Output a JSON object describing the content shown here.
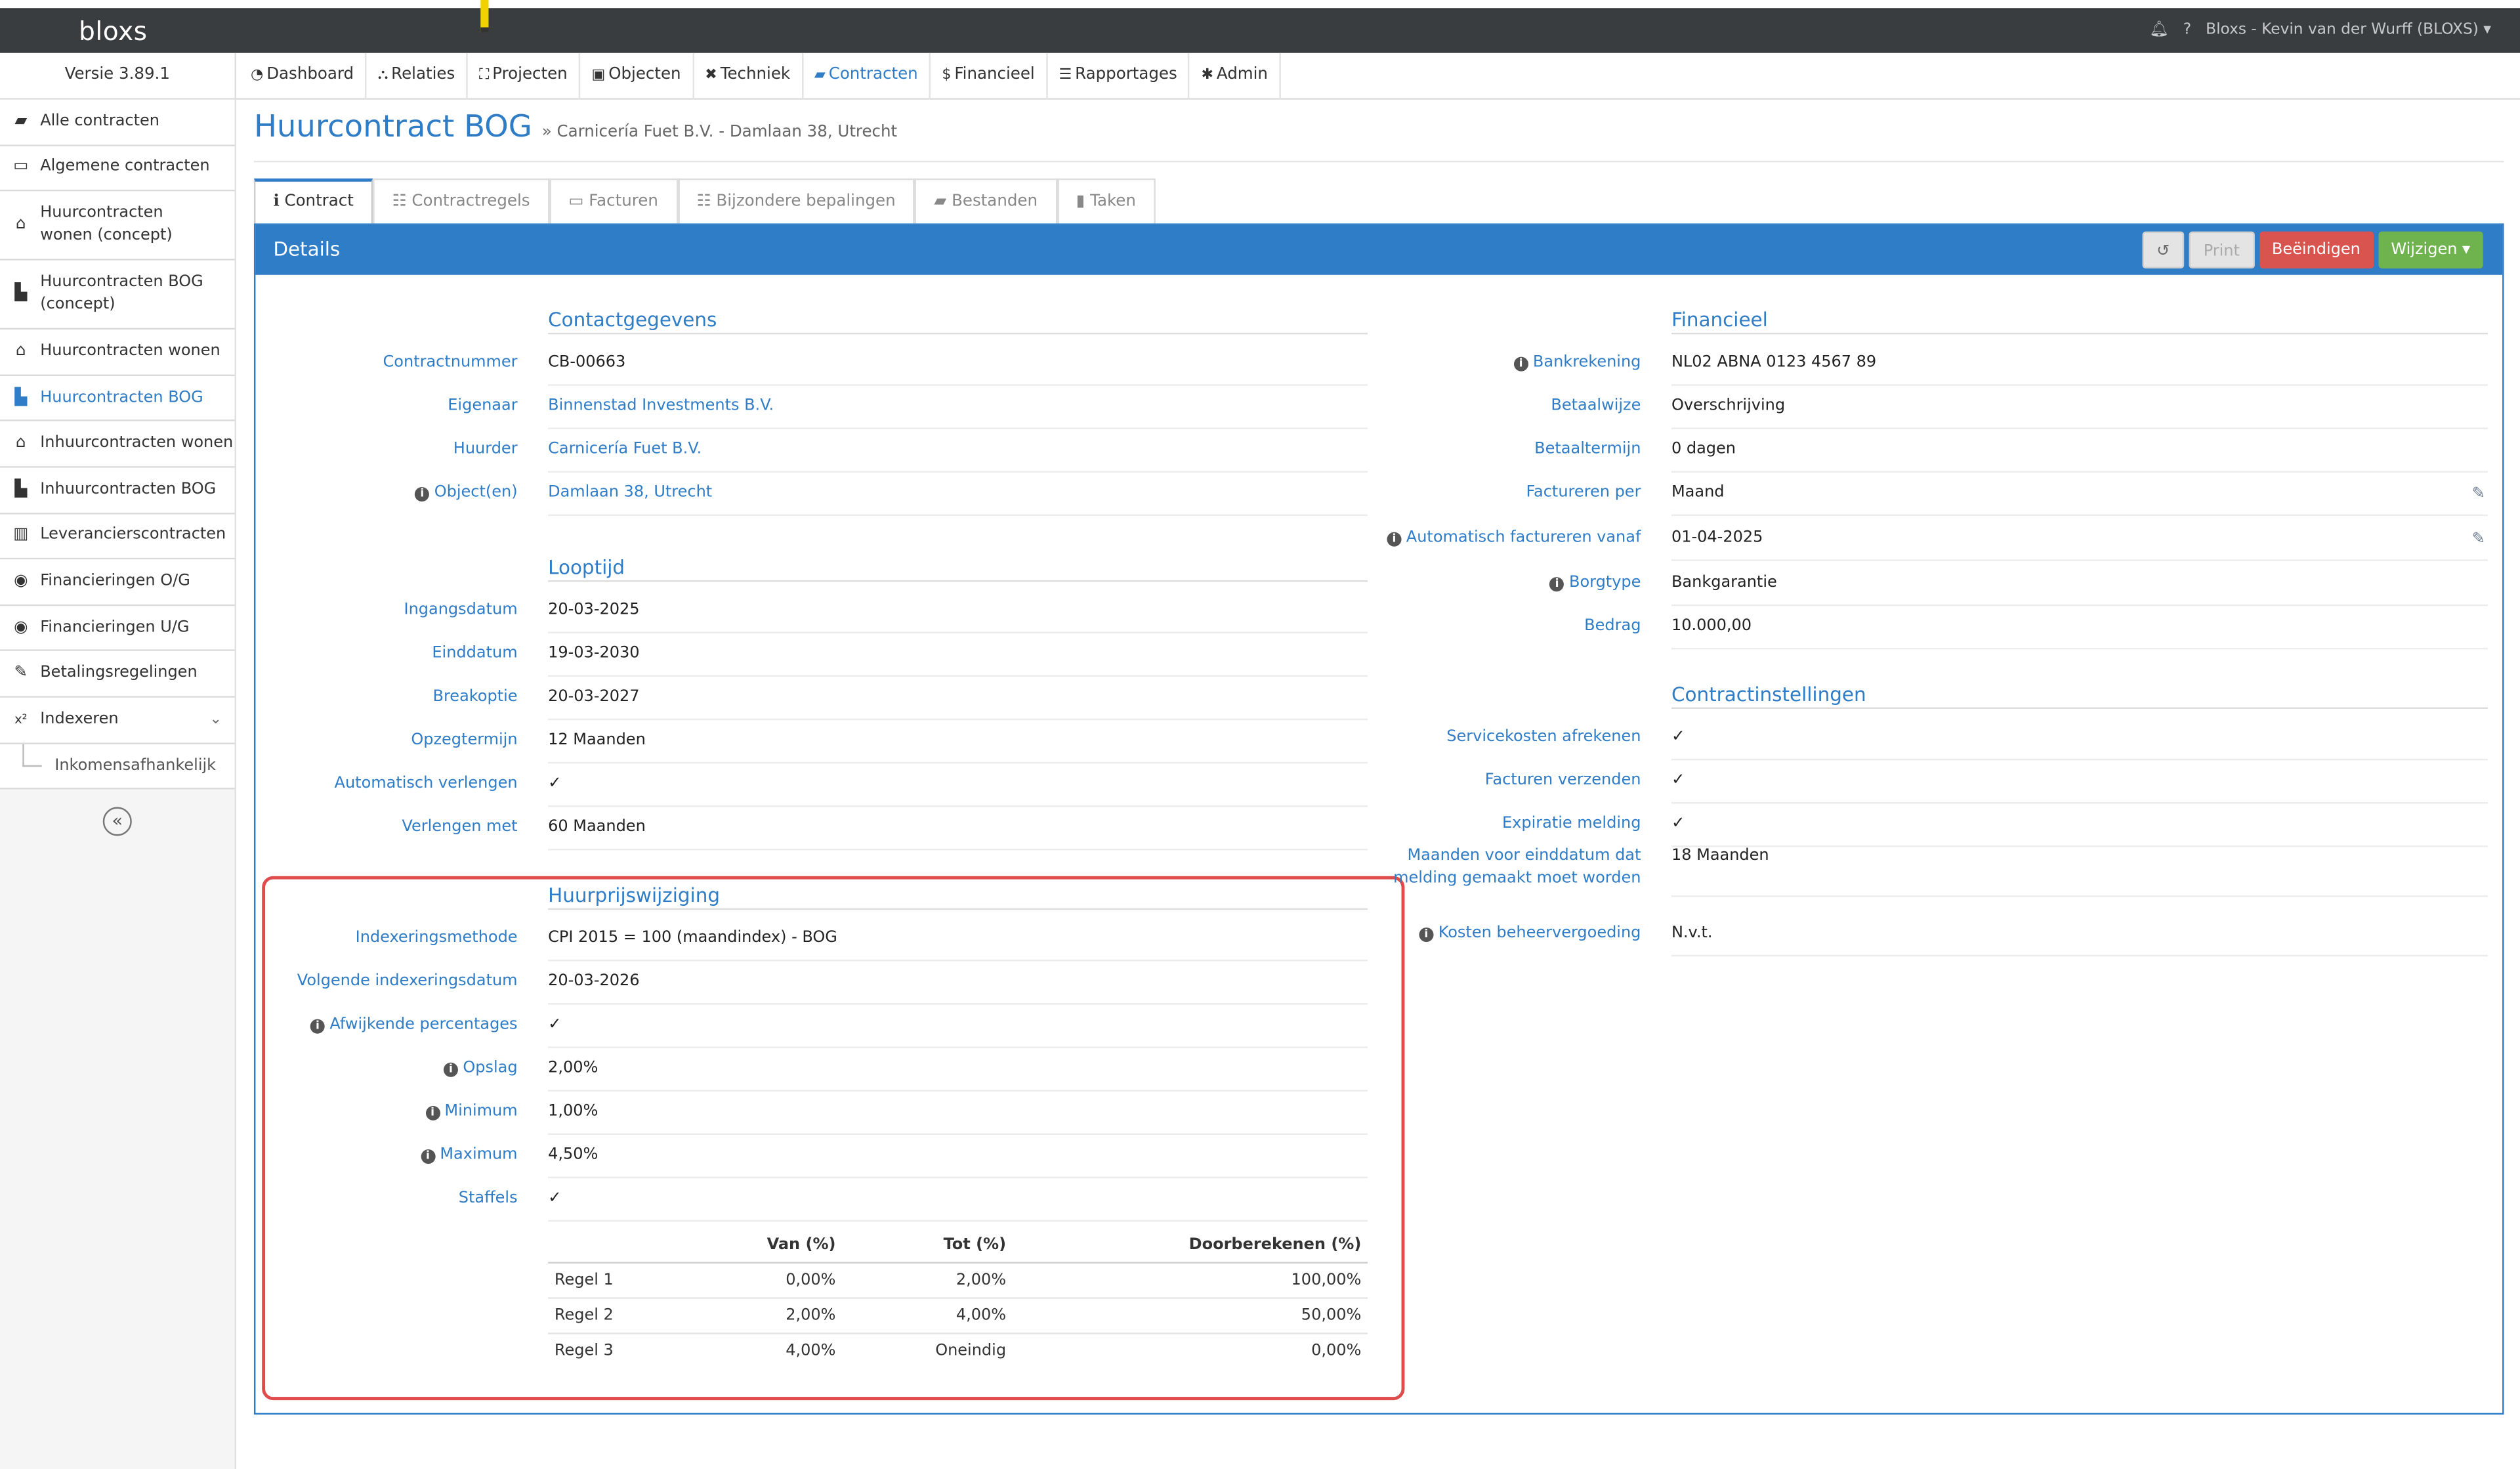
{
  "app": {
    "logo": "bloxs",
    "version": "Versie 3.89.1",
    "user": "Bloxs - Kevin van der Wurff (BLOXS)",
    "help": "?"
  },
  "nav": [
    {
      "label": "Dashboard",
      "icon": "dashboard-icon",
      "glyph": "◔"
    },
    {
      "label": "Relaties",
      "icon": "sitemap-icon",
      "glyph": "⛬"
    },
    {
      "label": "Projecten",
      "icon": "expand-icon",
      "glyph": "⛶"
    },
    {
      "label": "Objecten",
      "icon": "image-icon",
      "glyph": "▣"
    },
    {
      "label": "Techniek",
      "icon": "wrench-icon",
      "glyph": "✖"
    },
    {
      "label": "Contracten",
      "icon": "folder-open-icon",
      "glyph": "▰"
    },
    {
      "label": "Financieel",
      "icon": "dollar-icon",
      "glyph": "$"
    },
    {
      "label": "Rapportages",
      "icon": "list-icon",
      "glyph": "☰"
    },
    {
      "label": "Admin",
      "icon": "cog-icon",
      "glyph": "✱"
    }
  ],
  "sidebar": {
    "items": [
      {
        "label": "Alle contracten",
        "glyph": "▰",
        "icon": "folder-open-icon"
      },
      {
        "label": "Algemene contracten",
        "glyph": "▭",
        "icon": "calendar-icon"
      },
      {
        "label": "Huurcontracten wonen (concept)",
        "glyph": "⌂",
        "icon": "home-icon"
      },
      {
        "label": "Huurcontracten BOG (concept)",
        "glyph": "▙",
        "icon": "building-icon"
      },
      {
        "label": "Huurcontracten wonen",
        "glyph": "⌂",
        "icon": "home-icon"
      },
      {
        "label": "Huurcontracten BOG",
        "glyph": "▙",
        "icon": "building-icon"
      },
      {
        "label": "Inhuurcontracten wonen",
        "glyph": "⌂",
        "icon": "home-icon"
      },
      {
        "label": "Inhuurcontracten BOG",
        "glyph": "▙",
        "icon": "building-icon"
      },
      {
        "label": "Leverancierscontracten",
        "glyph": "▥",
        "icon": "briefcase-icon"
      },
      {
        "label": "Financieringen O/G",
        "glyph": "◉",
        "icon": "arrow-circle-icon"
      },
      {
        "label": "Financieringen U/G",
        "glyph": "◉",
        "icon": "arrow-circle-icon"
      },
      {
        "label": "Betalingsregelingen",
        "glyph": "✎",
        "icon": "handshake-icon"
      },
      {
        "label": "Indexeren",
        "glyph": "x²",
        "icon": "superscript-icon"
      }
    ],
    "sub_item": "Inkomensafhankelijk",
    "collapse_glyph": "«"
  },
  "page": {
    "title": "Huurcontract BOG",
    "subtitle": "» Carnicería Fuet B.V. - Damlaan 38, Utrecht"
  },
  "tabs": [
    {
      "label": "Contract",
      "glyph": "ℹ"
    },
    {
      "label": "Contractregels",
      "glyph": "☷"
    },
    {
      "label": "Facturen",
      "glyph": "▭"
    },
    {
      "label": "Bijzondere bepalingen",
      "glyph": "☷"
    },
    {
      "label": "Bestanden",
      "glyph": "▰"
    },
    {
      "label": "Taken",
      "glyph": "▮"
    }
  ],
  "panel": {
    "title": "Details",
    "history_glyph": "↺",
    "print": "Print",
    "end": "Beëindigen",
    "change": "Wijzigen ▾"
  },
  "contact": {
    "heading": "Contactgegevens",
    "rows": [
      {
        "label": "Contractnummer",
        "value": "CB-00663"
      },
      {
        "label": "Eigenaar",
        "value": "Binnenstad Investments B.V."
      },
      {
        "label": "Huurder",
        "value": "Carnicería Fuet B.V."
      },
      {
        "label": "Object(en)",
        "value": "Damlaan 38, Utrecht"
      }
    ]
  },
  "looptijd": {
    "heading": "Looptijd",
    "rows": [
      {
        "label": "Ingangsdatum",
        "value": "20-03-2025"
      },
      {
        "label": "Einddatum",
        "value": "19-03-2030"
      },
      {
        "label": "Breakoptie",
        "value": "20-03-2027"
      },
      {
        "label": "Opzegtermijn",
        "value": "12 Maanden"
      },
      {
        "label": "Automatisch verlengen",
        "value": "✓"
      },
      {
        "label": "Verlengen met",
        "value": "60 Maanden"
      }
    ]
  },
  "huurprijs": {
    "heading": "Huurprijswijziging",
    "rows": [
      {
        "label": "Indexeringsmethode",
        "value": "CPI 2015 = 100 (maandindex) - BOG"
      },
      {
        "label": "Volgende indexeringsdatum",
        "value": "20-03-2026"
      },
      {
        "label": "Afwijkende percentages",
        "value": "✓"
      },
      {
        "label": "Opslag",
        "value": "2,00%"
      },
      {
        "label": "Minimum",
        "value": "1,00%"
      },
      {
        "label": "Maximum",
        "value": "4,50%"
      },
      {
        "label": "Staffels",
        "value": "✓"
      }
    ],
    "staffel_headers": [
      "",
      "Van (%)",
      "Tot (%)",
      "Doorberekenen (%)"
    ],
    "staffel_rows": [
      [
        "Regel 1",
        "0,00%",
        "2,00%",
        "100,00%"
      ],
      [
        "Regel 2",
        "2,00%",
        "4,00%",
        "50,00%"
      ],
      [
        "Regel 3",
        "4,00%",
        "Oneindig",
        "0,00%"
      ]
    ]
  },
  "financieel": {
    "heading": "Financieel",
    "rows": [
      {
        "label": "Bankrekening",
        "value": "NL02 ABNA 0123 4567 89"
      },
      {
        "label": "Betaalwijze",
        "value": "Overschrijving"
      },
      {
        "label": "Betaaltermijn",
        "value": "0 dagen"
      },
      {
        "label": "Factureren per",
        "value": "Maand"
      },
      {
        "label": "Automatisch factureren vanaf",
        "value": "01-04-2025"
      },
      {
        "label": "Borgtype",
        "value": "Bankgarantie"
      },
      {
        "label": "Bedrag",
        "value": "10.000,00"
      }
    ]
  },
  "instellingen": {
    "heading": "Contractinstellingen",
    "rows": [
      {
        "label": "Servicekosten afrekenen",
        "value": "✓"
      },
      {
        "label": "Facturen verzenden",
        "value": "✓"
      },
      {
        "label": "Expiratie melding",
        "value": "✓"
      },
      {
        "label_line1": "Maanden voor einddatum dat",
        "label_line2": "melding gemaakt moet worden",
        "value": "18 Maanden"
      },
      {
        "label": "Kosten beheervergoeding",
        "value": "N.v.t."
      }
    ]
  },
  "colors": {
    "accent": "#2f7cc7",
    "danger": "#d9534f",
    "success": "#6fb34f",
    "topbar": "#3a3d40",
    "highlight": "#e04b4b"
  }
}
